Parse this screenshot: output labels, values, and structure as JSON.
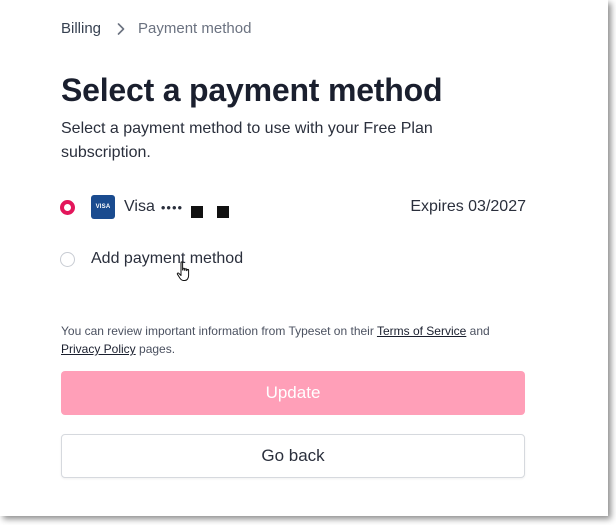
{
  "breadcrumb": {
    "parent": "Billing",
    "current": "Payment method"
  },
  "page": {
    "title": "Select a payment method",
    "subtitle": "Select a payment method to use with your Free Plan subscription."
  },
  "payment_options": {
    "saved_card": {
      "brand": "Visa",
      "badge_text": "VISA",
      "masked": "••••",
      "expires": "Expires 03/2027",
      "selected": true
    },
    "add_method": {
      "label": "Add payment method",
      "selected": false
    }
  },
  "legal": {
    "prefix": "You can review important information from Typeset on their",
    "terms_link": "Terms of Service",
    "middle": "and",
    "privacy_link": "Privacy Policy",
    "suffix": "pages."
  },
  "buttons": {
    "update": "Update",
    "go_back": "Go back"
  },
  "colors": {
    "accent": "#e3165b",
    "update_button": "#ff9fb8",
    "visa_badge": "#1a4b8f"
  },
  "icons": [
    "chevron-right-icon",
    "visa-card-icon",
    "hand-pointer-icon"
  ]
}
